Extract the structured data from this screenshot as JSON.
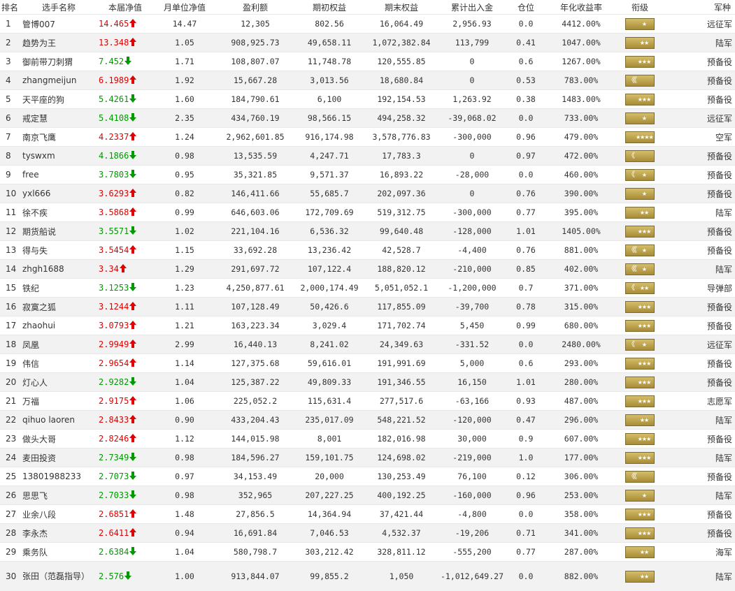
{
  "headers": [
    "排名",
    "选手名称",
    "本届净值",
    "月单位净值",
    "盈利额",
    "期初权益",
    "期末权益",
    "累计出入金",
    "仓位",
    "年化收益率",
    "衔级",
    "军种"
  ],
  "colors": {
    "up": "#e00000",
    "down": "#009900",
    "badge": "#b89c45"
  },
  "rows": [
    {
      "rank": "1",
      "name": "管博007",
      "net": "14.465",
      "dir": "up",
      "monthly": "14.47",
      "profit": "12,305",
      "start": "802.56",
      "end": "16,064.49",
      "flow": "2,956.93",
      "position": "0.0",
      "annual": "4412.00%",
      "badge": {
        "bars": "",
        "stars": "★"
      },
      "branch": "远征军"
    },
    {
      "rank": "2",
      "name": "趋势为王",
      "net": "13.348",
      "dir": "up",
      "monthly": "1.05",
      "profit": "908,925.73",
      "start": "49,658.11",
      "end": "1,072,382.84",
      "flow": "113,799",
      "position": "0.41",
      "annual": "1047.00%",
      "badge": {
        "bars": "",
        "stars": "★★"
      },
      "branch": "陆军"
    },
    {
      "rank": "3",
      "name": "御前带刀刺猬",
      "net": "7.452",
      "dir": "down",
      "monthly": "1.71",
      "profit": "108,807.07",
      "start": "11,748.78",
      "end": "120,555.85",
      "flow": "0",
      "position": "0.6",
      "annual": "1267.00%",
      "badge": {
        "bars": "",
        "stars": "★★★"
      },
      "branch": "预备役"
    },
    {
      "rank": "4",
      "name": "zhangmeijun",
      "net": "6.1989",
      "dir": "up",
      "monthly": "1.92",
      "profit": "15,667.28",
      "start": "3,013.56",
      "end": "18,680.84",
      "flow": "0",
      "position": "0.53",
      "annual": "783.00%",
      "badge": {
        "bars": "《《",
        "stars": ""
      },
      "branch": "预备役"
    },
    {
      "rank": "5",
      "name": "天平座的狗",
      "net": "5.4261",
      "dir": "down",
      "monthly": "1.60",
      "profit": "184,790.61",
      "start": "6,100",
      "end": "192,154.53",
      "flow": "1,263.92",
      "position": "0.38",
      "annual": "1483.00%",
      "badge": {
        "bars": "",
        "stars": "★★★"
      },
      "branch": "预备役"
    },
    {
      "rank": "6",
      "name": "戒定慧",
      "net": "5.4108",
      "dir": "down",
      "monthly": "2.35",
      "profit": "434,760.19",
      "start": "98,566.15",
      "end": "494,258.32",
      "flow": "-39,068.02",
      "position": "0.0",
      "annual": "733.00%",
      "badge": {
        "bars": "",
        "stars": "★"
      },
      "branch": "远征军"
    },
    {
      "rank": "7",
      "name": "南京飞鹰",
      "net": "4.2337",
      "dir": "up",
      "monthly": "1.24",
      "profit": "2,962,601.85",
      "start": "916,174.98",
      "end": "3,578,776.83",
      "flow": "-300,000",
      "position": "0.96",
      "annual": "479.00%",
      "badge": {
        "bars": "",
        "stars": "★★★★"
      },
      "branch": "空军"
    },
    {
      "rank": "8",
      "name": "tyswxm",
      "net": "4.1866",
      "dir": "down",
      "monthly": "0.98",
      "profit": "13,535.59",
      "start": "4,247.71",
      "end": "17,783.3",
      "flow": "0",
      "position": "0.97",
      "annual": "472.00%",
      "badge": {
        "bars": "《",
        "stars": ""
      },
      "branch": "预备役"
    },
    {
      "rank": "9",
      "name": "free",
      "net": "3.7803",
      "dir": "down",
      "monthly": "0.95",
      "profit": "35,321.85",
      "start": "9,571.37",
      "end": "16,893.22",
      "flow": "-28,000",
      "position": "0.0",
      "annual": "460.00%",
      "badge": {
        "bars": "《",
        "stars": "★"
      },
      "branch": "预备役"
    },
    {
      "rank": "10",
      "name": "yxl666",
      "net": "3.6293",
      "dir": "up",
      "monthly": "0.82",
      "profit": "146,411.66",
      "start": "55,685.7",
      "end": "202,097.36",
      "flow": "0",
      "position": "0.76",
      "annual": "390.00%",
      "badge": {
        "bars": "",
        "stars": "★"
      },
      "branch": "预备役"
    },
    {
      "rank": "11",
      "name": "徐不疾",
      "net": "3.5868",
      "dir": "up",
      "monthly": "0.99",
      "profit": "646,603.06",
      "start": "172,709.69",
      "end": "519,312.75",
      "flow": "-300,000",
      "position": "0.77",
      "annual": "395.00%",
      "badge": {
        "bars": "",
        "stars": "★★"
      },
      "branch": "陆军"
    },
    {
      "rank": "12",
      "name": "期货船说",
      "net": "3.5571",
      "dir": "down",
      "monthly": "1.02",
      "profit": "221,104.16",
      "start": "6,536.32",
      "end": "99,640.48",
      "flow": "-128,000",
      "position": "1.01",
      "annual": "1405.00%",
      "badge": {
        "bars": "",
        "stars": "★★★"
      },
      "branch": "预备役"
    },
    {
      "rank": "13",
      "name": "得与失",
      "net": "3.5454",
      "dir": "up",
      "monthly": "1.15",
      "profit": "33,692.28",
      "start": "13,236.42",
      "end": "42,528.7",
      "flow": "-4,400",
      "position": "0.76",
      "annual": "881.00%",
      "badge": {
        "bars": "《《",
        "stars": "★"
      },
      "branch": "预备役"
    },
    {
      "rank": "14",
      "name": "zhgh1688",
      "net": "3.34",
      "dir": "up",
      "monthly": "1.29",
      "profit": "291,697.72",
      "start": "107,122.4",
      "end": "188,820.12",
      "flow": "-210,000",
      "position": "0.85",
      "annual": "402.00%",
      "badge": {
        "bars": "《《",
        "stars": "★"
      },
      "branch": "陆军"
    },
    {
      "rank": "15",
      "name": "铁纪",
      "net": "3.1253",
      "dir": "down",
      "monthly": "1.23",
      "profit": "4,250,877.61",
      "start": "2,000,174.49",
      "end": "5,051,052.1",
      "flow": "-1,200,000",
      "position": "0.7",
      "annual": "371.00%",
      "badge": {
        "bars": "《",
        "stars": "★★"
      },
      "branch": "导弹部"
    },
    {
      "rank": "16",
      "name": "寂寞之狐",
      "net": "3.1244",
      "dir": "up",
      "monthly": "1.11",
      "profit": "107,128.49",
      "start": "50,426.6",
      "end": "117,855.09",
      "flow": "-39,700",
      "position": "0.78",
      "annual": "315.00%",
      "badge": {
        "bars": "",
        "stars": "★★★"
      },
      "branch": "预备役"
    },
    {
      "rank": "17",
      "name": "zhaohui",
      "net": "3.0793",
      "dir": "up",
      "monthly": "1.21",
      "profit": "163,223.34",
      "start": "3,029.4",
      "end": "171,702.74",
      "flow": "5,450",
      "position": "0.99",
      "annual": "680.00%",
      "badge": {
        "bars": "",
        "stars": "★★★"
      },
      "branch": "预备役"
    },
    {
      "rank": "18",
      "name": "凤凰",
      "net": "2.9949",
      "dir": "up",
      "monthly": "2.99",
      "profit": "16,440.13",
      "start": "8,241.02",
      "end": "24,349.63",
      "flow": "-331.52",
      "position": "0.0",
      "annual": "2480.00%",
      "badge": {
        "bars": "《",
        "stars": "★"
      },
      "branch": "远征军"
    },
    {
      "rank": "19",
      "name": "伟信",
      "net": "2.9654",
      "dir": "up",
      "monthly": "1.14",
      "profit": "127,375.68",
      "start": "59,616.01",
      "end": "191,991.69",
      "flow": "5,000",
      "position": "0.6",
      "annual": "293.00%",
      "badge": {
        "bars": "",
        "stars": "★★★"
      },
      "branch": "预备役"
    },
    {
      "rank": "20",
      "name": "灯心人",
      "net": "2.9282",
      "dir": "down",
      "monthly": "1.04",
      "profit": "125,387.22",
      "start": "49,809.33",
      "end": "191,346.55",
      "flow": "16,150",
      "position": "1.01",
      "annual": "280.00%",
      "badge": {
        "bars": "",
        "stars": "★★★"
      },
      "branch": "预备役"
    },
    {
      "rank": "21",
      "name": "万福",
      "net": "2.9175",
      "dir": "up",
      "monthly": "1.06",
      "profit": "225,052.2",
      "start": "115,631.4",
      "end": "277,517.6",
      "flow": "-63,166",
      "position": "0.93",
      "annual": "487.00%",
      "badge": {
        "bars": "",
        "stars": "★★★"
      },
      "branch": "志愿军"
    },
    {
      "rank": "22",
      "name": "qihuo laoren",
      "net": "2.8433",
      "dir": "up",
      "monthly": "0.90",
      "profit": "433,204.43",
      "start": "235,017.09",
      "end": "548,221.52",
      "flow": "-120,000",
      "position": "0.47",
      "annual": "296.00%",
      "badge": {
        "bars": "",
        "stars": "★★"
      },
      "branch": "陆军"
    },
    {
      "rank": "23",
      "name": "做头大哥",
      "net": "2.8246",
      "dir": "up",
      "monthly": "1.12",
      "profit": "144,015.98",
      "start": "8,001",
      "end": "182,016.98",
      "flow": "30,000",
      "position": "0.9",
      "annual": "607.00%",
      "badge": {
        "bars": "",
        "stars": "★★★"
      },
      "branch": "预备役"
    },
    {
      "rank": "24",
      "name": "麦田投资",
      "net": "2.7349",
      "dir": "down",
      "monthly": "0.98",
      "profit": "184,596.27",
      "start": "159,101.75",
      "end": "124,698.02",
      "flow": "-219,000",
      "position": "1.0",
      "annual": "177.00%",
      "badge": {
        "bars": "",
        "stars": "★★★"
      },
      "branch": "陆军"
    },
    {
      "rank": "25",
      "name": "13801988233",
      "net": "2.7073",
      "dir": "down",
      "monthly": "0.97",
      "profit": "34,153.49",
      "start": "20,000",
      "end": "130,253.49",
      "flow": "76,100",
      "position": "0.12",
      "annual": "306.00%",
      "badge": {
        "bars": "《《",
        "stars": ""
      },
      "branch": "预备役"
    },
    {
      "rank": "26",
      "name": "思思飞",
      "net": "2.7033",
      "dir": "down",
      "monthly": "0.98",
      "profit": "352,965",
      "start": "207,227.25",
      "end": "400,192.25",
      "flow": "-160,000",
      "position": "0.96",
      "annual": "253.00%",
      "badge": {
        "bars": "",
        "stars": "★"
      },
      "branch": "陆军"
    },
    {
      "rank": "27",
      "name": "业余八段",
      "net": "2.6851",
      "dir": "up",
      "monthly": "1.48",
      "profit": "27,856.5",
      "start": "14,364.94",
      "end": "37,421.44",
      "flow": "-4,800",
      "position": "0.0",
      "annual": "358.00%",
      "badge": {
        "bars": "",
        "stars": "★★★"
      },
      "branch": "预备役"
    },
    {
      "rank": "28",
      "name": "李永杰",
      "net": "2.6411",
      "dir": "up",
      "monthly": "0.94",
      "profit": "16,691.84",
      "start": "7,046.53",
      "end": "4,532.37",
      "flow": "-19,206",
      "position": "0.71",
      "annual": "341.00%",
      "badge": {
        "bars": "",
        "stars": "★★★"
      },
      "branch": "预备役"
    },
    {
      "rank": "29",
      "name": "乘务队",
      "net": "2.6384",
      "dir": "down",
      "monthly": "1.04",
      "profit": "580,798.7",
      "start": "303,212.42",
      "end": "328,811.12",
      "flow": "-555,200",
      "position": "0.77",
      "annual": "287.00%",
      "badge": {
        "bars": "",
        "stars": "★★"
      },
      "branch": "海军"
    },
    {
      "rank": "30",
      "name": "张田（范磊指导）",
      "net": "2.576",
      "dir": "down",
      "monthly": "1.00",
      "profit": "913,844.07",
      "start": "99,855.2",
      "end": "1,050",
      "flow": "-1,012,649.27",
      "position": "0.0",
      "annual": "882.00%",
      "badge": {
        "bars": "",
        "stars": "★★"
      },
      "branch": "陆军"
    }
  ]
}
